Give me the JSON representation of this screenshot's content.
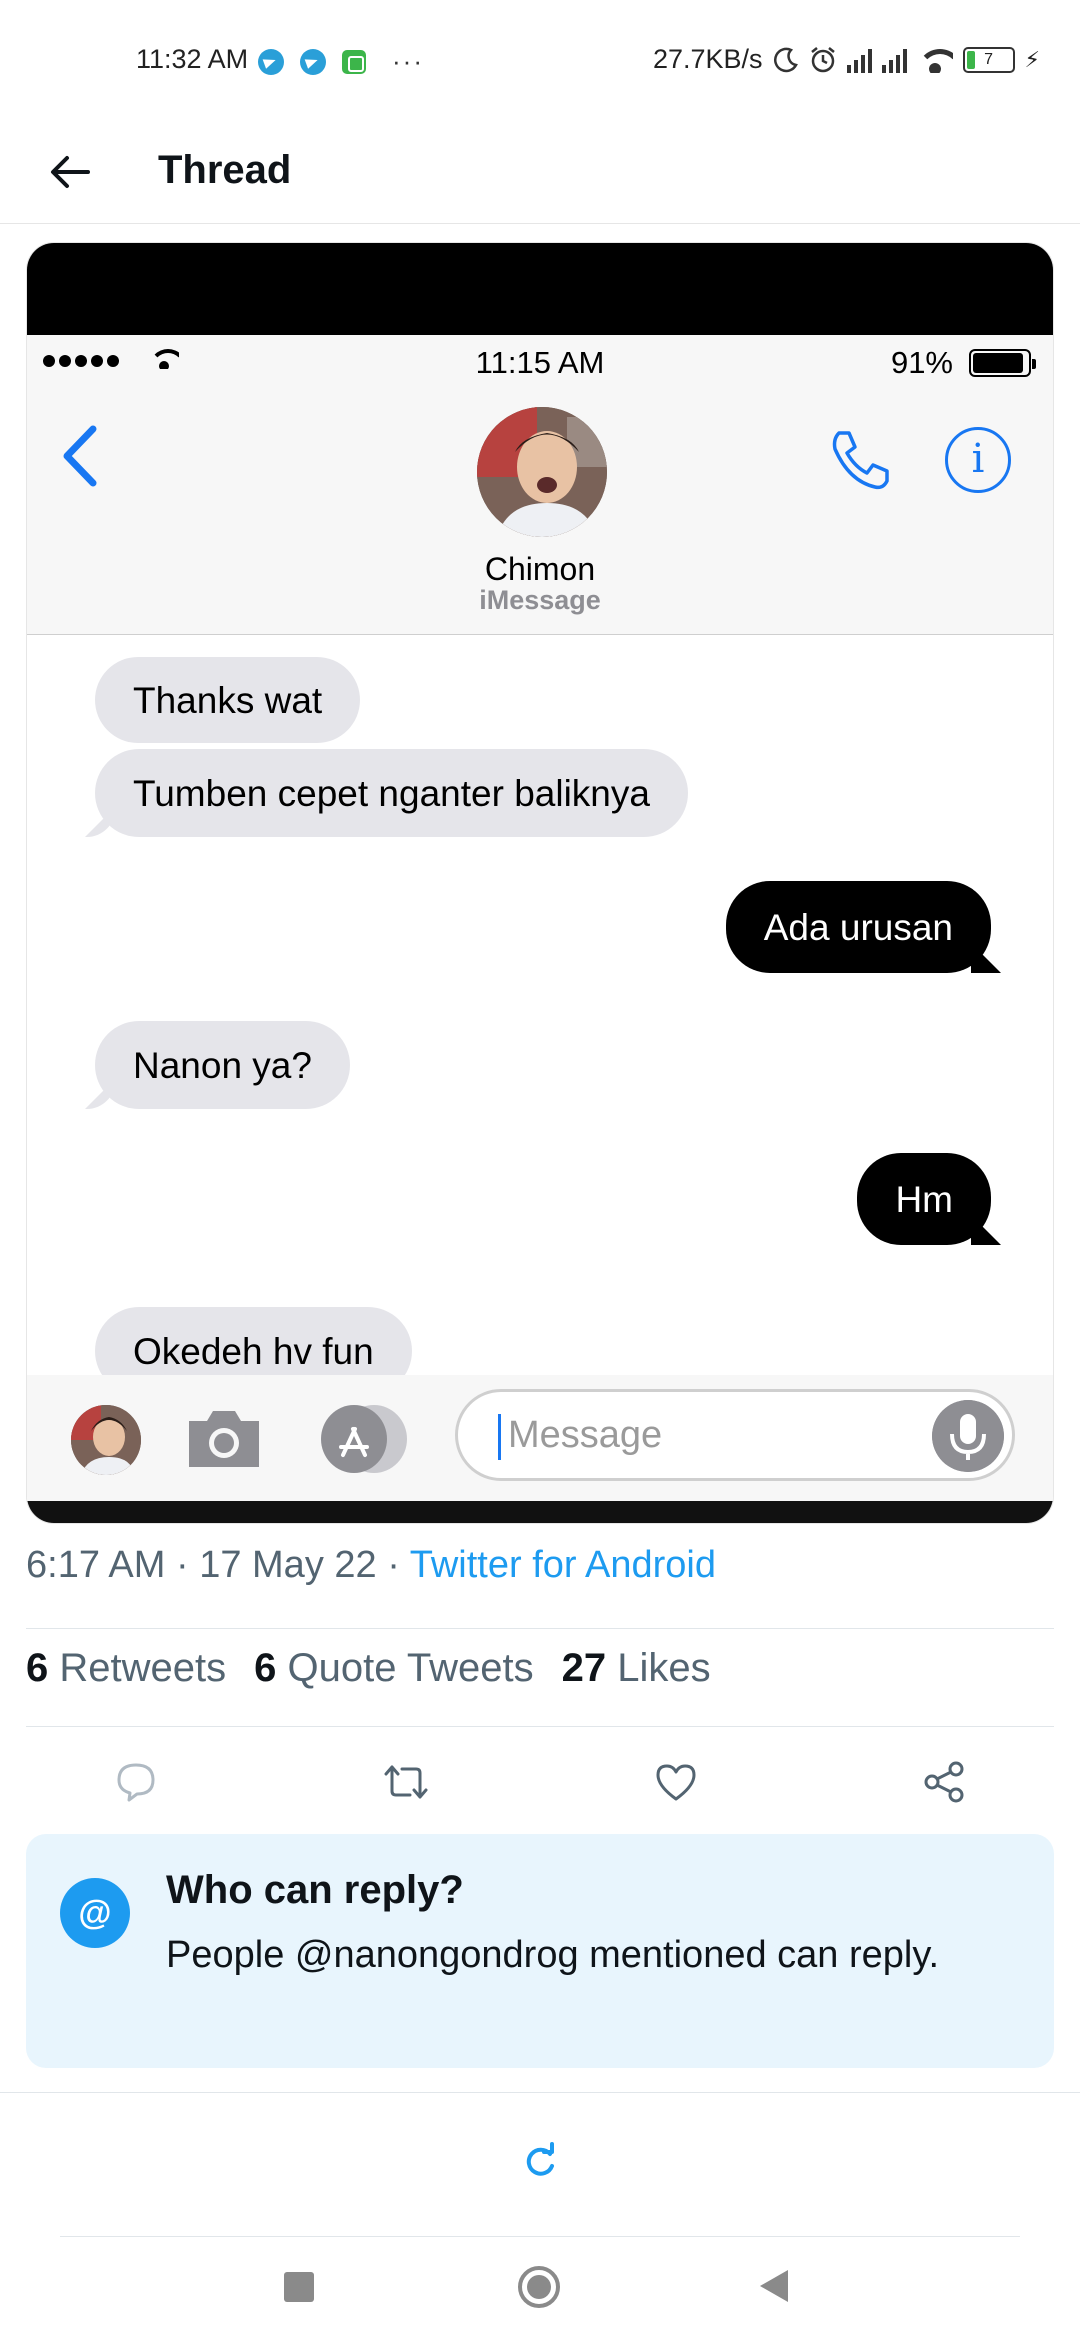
{
  "status_bar": {
    "time": "11:32 AM",
    "notification_icons": [
      "telegram-icon",
      "telegram-icon",
      "green-app-icon"
    ],
    "more": "···",
    "net_speed": "27.7KB/s",
    "right_icons": [
      "moon-icon",
      "alarm-icon",
      "signal-icon",
      "signal-icon",
      "wifi-icon"
    ],
    "battery_level": "7",
    "charging": true
  },
  "header": {
    "title": "Thread"
  },
  "embedded_screenshot": {
    "ios_status": {
      "time": "11:15 AM",
      "battery": "91%"
    },
    "contact_name": "Chimon",
    "service_label": "iMessage",
    "messages": [
      {
        "direction": "in",
        "text": "Thanks wat"
      },
      {
        "direction": "in",
        "text": "Tumben cepet nganter baliknya"
      },
      {
        "direction": "out",
        "text": "Ada urusan"
      },
      {
        "direction": "in",
        "text": "Nanon ya?"
      },
      {
        "direction": "out",
        "text": "Hm"
      },
      {
        "direction": "in",
        "text": "Okedeh hv fun"
      }
    ],
    "composer": {
      "placeholder": "Message"
    },
    "accent_color": "#1877f2"
  },
  "tweet": {
    "time": "6:17 AM",
    "date": "17 May 22",
    "source": "Twitter for Android",
    "retweets_count": "6",
    "retweets_label": "Retweets",
    "quotes_count": "6",
    "quotes_label": "Quote Tweets",
    "likes_count": "27",
    "likes_label": "Likes",
    "link_color": "#1d9bf0"
  },
  "reply_notice": {
    "title": "Who can reply?",
    "body": "People @nanongondrog mentioned can reply."
  }
}
